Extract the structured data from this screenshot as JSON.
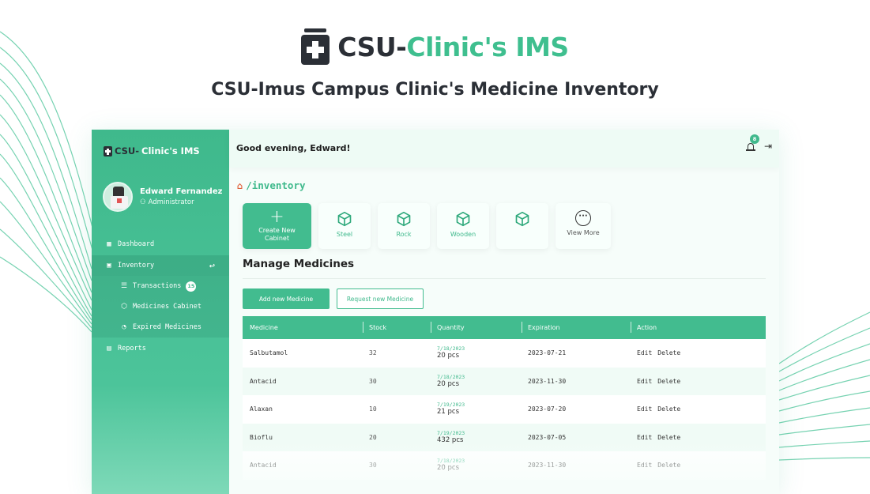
{
  "hero": {
    "brand_dark": "CSU-",
    "brand_green": "Clinic's IMS",
    "subtitle": "CSU-Imus Campus Clinic's Medicine Inventory"
  },
  "sidebar": {
    "brand_dark": "CSU-",
    "brand_green": "Clinic's IMS",
    "profile": {
      "name": "Edward Fernandez",
      "role": "Administrator"
    },
    "items": [
      {
        "label": "Dashboard",
        "icon": "dashboard-icon"
      },
      {
        "label": "Inventory",
        "icon": "inventory-icon"
      },
      {
        "label": "Transactions",
        "icon": "list-icon",
        "badge": "15"
      },
      {
        "label": "Medicines Cabinet",
        "icon": "cube-icon"
      },
      {
        "label": "Expired Medicines",
        "icon": "clock-search-icon"
      },
      {
        "label": "Reports",
        "icon": "document-icon"
      }
    ]
  },
  "topbar": {
    "greeting": "Good evening, Edward!",
    "notification_count": "8"
  },
  "breadcrumb": "/inventory",
  "cabinets": [
    {
      "label": "Create New Cabinet",
      "icon": "plus-icon"
    },
    {
      "label": "Steel",
      "icon": "cube-icon"
    },
    {
      "label": "Rock",
      "icon": "cube-icon"
    },
    {
      "label": "Wooden",
      "icon": "cube-icon"
    },
    {
      "label": "",
      "icon": "cube-icon"
    },
    {
      "label": "View More",
      "icon": "more-dots-icon"
    }
  ],
  "main": {
    "title": "Manage Medicines",
    "add_button": "Add new Medicine",
    "request_button": "Request new Medicine"
  },
  "table": {
    "columns": [
      "Medicine",
      "Stock",
      "Quantity",
      "Expiration",
      "Action"
    ],
    "rows": [
      {
        "medicine": "Salbutamol",
        "stock": "32",
        "qty_date": "7/18/2023",
        "qty": "20 pcs",
        "expiration": "2023-07-21"
      },
      {
        "medicine": "Antacid",
        "stock": "30",
        "qty_date": "7/18/2023",
        "qty": "20 pcs",
        "expiration": "2023-11-30"
      },
      {
        "medicine": "Alaxan",
        "stock": "10",
        "qty_date": "7/19/2023",
        "qty": "21 pcs",
        "expiration": "2023-07-20"
      },
      {
        "medicine": "Bioflu",
        "stock": "20",
        "qty_date": "7/19/2023",
        "qty": "432 pcs",
        "expiration": "2023-07-05"
      },
      {
        "medicine": "Antacid",
        "stock": "30",
        "qty_date": "7/18/2023",
        "qty": "20 pcs",
        "expiration": "2023-11-30"
      }
    ],
    "edit_label": "Edit",
    "delete_label": "Delete"
  },
  "colors": {
    "accent": "#42bc8f",
    "dark": "#2b2f36"
  }
}
